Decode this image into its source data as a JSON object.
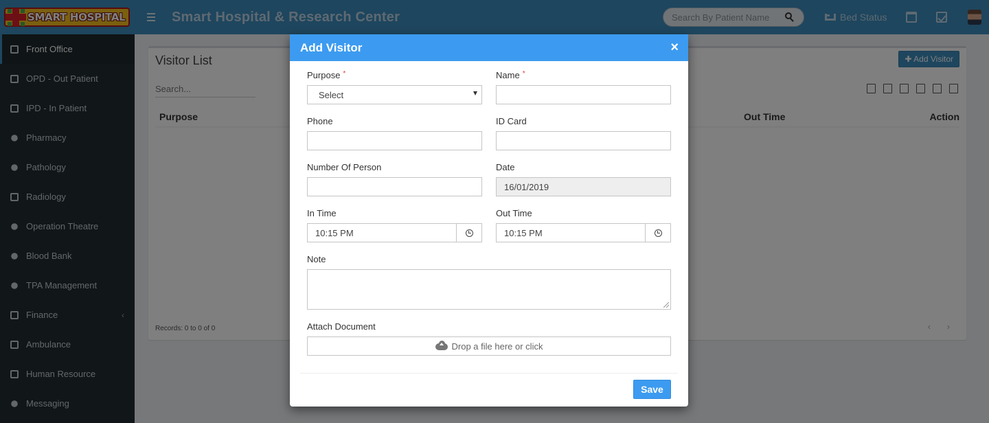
{
  "header": {
    "logo_text": "SMART HOSPITAL",
    "title": "Smart Hospital & Research Center",
    "search_placeholder": "Search By Patient Name",
    "bed_status_label": "Bed Status"
  },
  "sidebar": {
    "items": [
      {
        "label": "Front Office",
        "icon": "building-icon",
        "active": true
      },
      {
        "label": "OPD - Out Patient",
        "icon": "stethoscope-icon"
      },
      {
        "label": "IPD - In Patient",
        "icon": "bed-icon"
      },
      {
        "label": "Pharmacy",
        "icon": "mortar-pestle-icon"
      },
      {
        "label": "Pathology",
        "icon": "flask-icon"
      },
      {
        "label": "Radiology",
        "icon": "microscope-icon"
      },
      {
        "label": "Operation Theatre",
        "icon": "scissors-icon"
      },
      {
        "label": "Blood Bank",
        "icon": "blood-drop-icon"
      },
      {
        "label": "TPA Management",
        "icon": "umbrella-icon"
      },
      {
        "label": "Finance",
        "icon": "money-icon",
        "chevron": "‹"
      },
      {
        "label": "Ambulance",
        "icon": "ambulance-icon"
      },
      {
        "label": "Human Resource",
        "icon": "sitemap-icon"
      },
      {
        "label": "Messaging",
        "icon": "megaphone-icon"
      }
    ]
  },
  "page": {
    "panel_title": "Visitor List",
    "add_button": "✚ Add Visitor",
    "search_placeholder": "Search...",
    "columns": {
      "purpose": "Purpose",
      "out_time": "Out Time",
      "action": "Action"
    },
    "records_text": "Records: 0 to 0 of 0",
    "pager": "‹ ›"
  },
  "modal": {
    "title": "Add Visitor",
    "close": "×",
    "required_mark": "*",
    "fields": {
      "purpose": {
        "label": "Purpose",
        "value": "Select"
      },
      "name": {
        "label": "Name",
        "value": ""
      },
      "phone": {
        "label": "Phone",
        "value": ""
      },
      "id_card": {
        "label": "ID Card",
        "value": ""
      },
      "number_of_person": {
        "label": "Number Of Person",
        "value": ""
      },
      "date": {
        "label": "Date",
        "value": "16/01/2019"
      },
      "in_time": {
        "label": "In Time",
        "value": "10:15 PM"
      },
      "out_time": {
        "label": "Out Time",
        "value": "10:15 PM"
      },
      "note": {
        "label": "Note",
        "value": ""
      },
      "attach": {
        "label": "Attach Document",
        "dropzone_text": "Drop a file here or click"
      }
    },
    "save_label": "Save"
  },
  "colors": {
    "header_bg": "#3c8dbc",
    "sidebar_bg": "#222d32",
    "modal_header_bg": "#3c9bf0",
    "required": "#e43c3c"
  }
}
